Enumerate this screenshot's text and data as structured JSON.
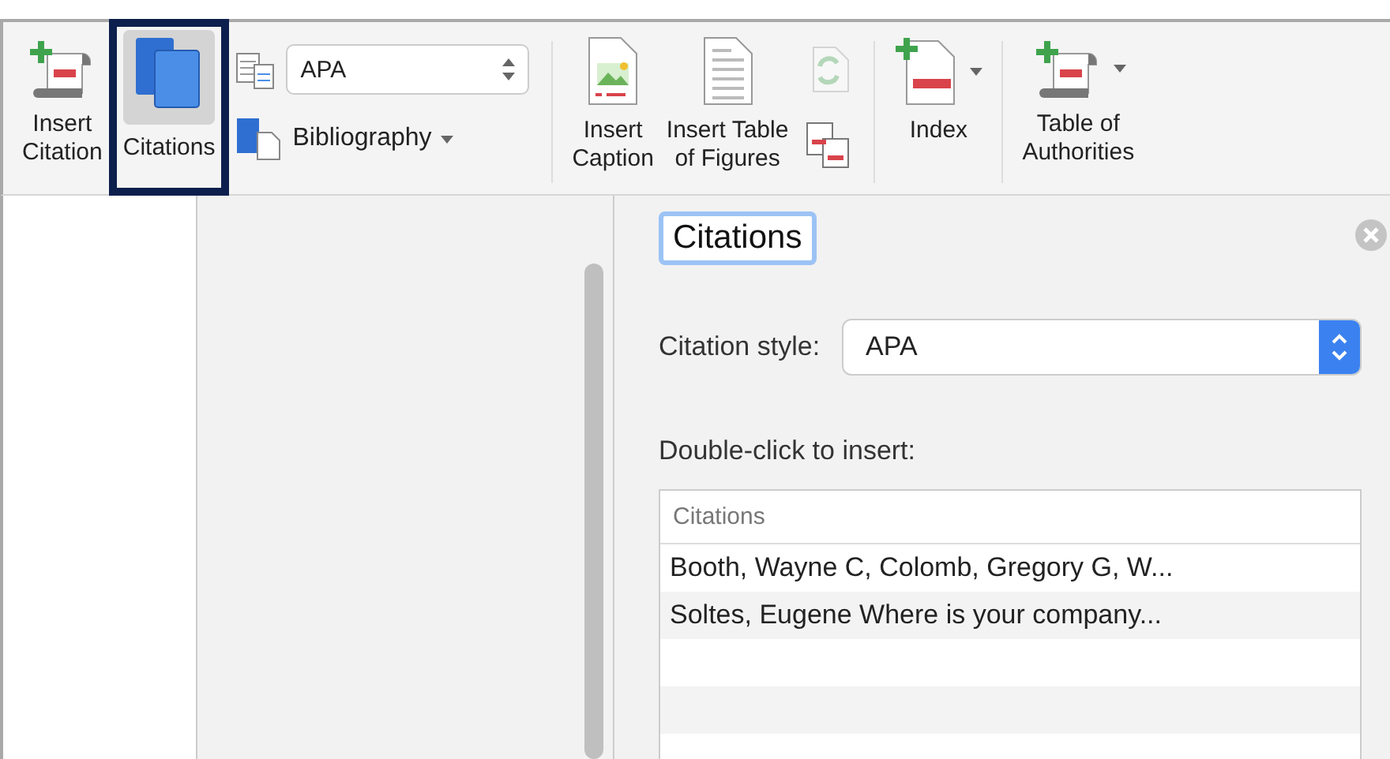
{
  "ribbon": {
    "insert_citation": {
      "label": "Insert\nCitation"
    },
    "citations": {
      "label": "Citations",
      "on": true
    },
    "style_select": {
      "value": "APA"
    },
    "bibliography": {
      "label": "Bibliography"
    },
    "insert_caption": {
      "label": "Insert\nCaption"
    },
    "insert_table_of_figures": {
      "label": "Insert Table\nof Figures"
    },
    "update_table": {
      "disabled": true
    },
    "index": {
      "label": "Index"
    },
    "table_of_authorities": {
      "label": "Table of\nAuthorities"
    }
  },
  "panel": {
    "title": "Citations",
    "citation_style": {
      "label": "Citation style:",
      "value": "APA"
    },
    "instruction": "Double-click to insert:",
    "list": {
      "column": "Citations",
      "rows": [
        {
          "text": "Booth, Wayne C, Colomb, Gregory G, W..."
        },
        {
          "text": "Soltes, Eugene Where is your company..."
        }
      ]
    }
  }
}
